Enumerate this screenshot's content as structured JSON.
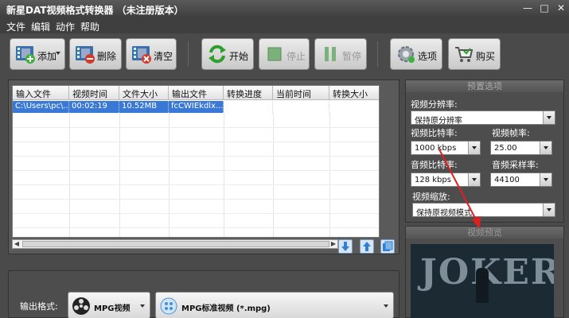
{
  "window": {
    "title": "新星DAT视频格式转换器 （未注册版本）"
  },
  "menu": [
    "文件",
    "编辑",
    "动作",
    "帮助"
  ],
  "toolbar": {
    "add": "添加",
    "delete": "删除",
    "clear": "清空",
    "start": "开始",
    "stop": "停止",
    "pause": "暂停",
    "options": "选项",
    "buy": "购买"
  },
  "file_list": {
    "columns": [
      "输入文件",
      "视频时间",
      "文件大小",
      "输出文件",
      "转换进度",
      "当前时间",
      "转换大小"
    ],
    "rows": [
      [
        "C:\\Users\\pc\\...",
        "00:02:19",
        "10.52MB",
        "fcCWIEkdlx...",
        "",
        "",
        ""
      ]
    ]
  },
  "presets": {
    "title": "预置选项",
    "resolution_label": "视频分辨率:",
    "resolution_value": "保持原分辨率",
    "video_bitrate_label": "视频比特率:",
    "video_bitrate_value": "1000 kbps",
    "framerate_label": "视频帧率:",
    "framerate_value": "25.00",
    "audio_bitrate_label": "音频比特率:",
    "audio_bitrate_value": "128 kbps",
    "samplerate_label": "音频采样率:",
    "samplerate_value": "44100",
    "scale_label": "视频缩放:",
    "scale_value": "保持原视频模式"
  },
  "preview": {
    "title": "视频预览",
    "poster_text": "JOKER"
  },
  "output": {
    "label": "输出格式:",
    "category": "MPG视频",
    "format": "MPG标准视频 (*.mpg)"
  },
  "colors": {
    "selection": "#3a78d6",
    "annotation_arrow": "#e02020"
  }
}
